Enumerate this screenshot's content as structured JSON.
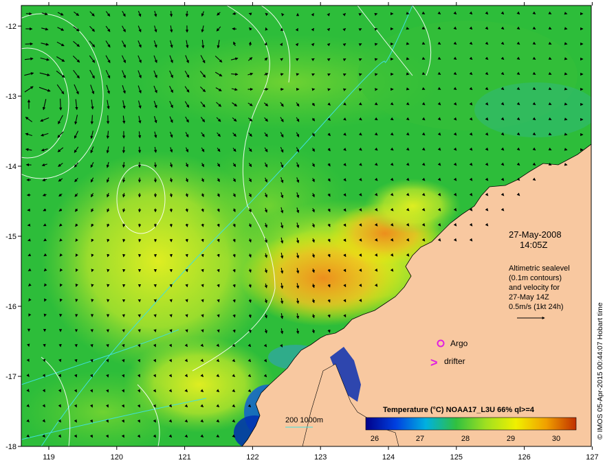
{
  "map": {
    "date_line": "27-May-2008",
    "time_line": "14:05Z",
    "legend_text": [
      "Altimetric sealevel",
      "(0.1m contours)",
      "and velocity for",
      "27-May 14Z",
      "0.5m/s (1kt 24h)"
    ],
    "argo_label": "Argo",
    "drifter_label": "drifter",
    "drifter_marker": ">",
    "bathymetry_label": "200  1000m",
    "colorbar_title": "Temperature (°C) NOAA17_L3U 66% ql>=4",
    "colorbar_ticks": [
      "26",
      "27",
      "28",
      "29",
      "30"
    ],
    "credit": "© IMOS 05-Apr-2015 00:44:07 Hobart time",
    "lon_ticks": [
      "119",
      "120",
      "121",
      "122",
      "123",
      "124",
      "125",
      "126",
      "127"
    ],
    "lat_ticks": [
      "-12",
      "-13",
      "-14",
      "-15",
      "-16",
      "-17",
      "-18"
    ],
    "colors": {
      "land": "#f8c8a0",
      "ocean_base": "#2dbd3a",
      "warm_patch": "#f0a020",
      "argo_marker": "#e020e0",
      "bathymetry_line": "#40e0e0",
      "sealevel_contour": "#ffffff",
      "velocity_arrow": "#000000",
      "colorbar_stops": [
        "#00008a",
        "#0040e0",
        "#00b0e0",
        "#30c040",
        "#a0e020",
        "#f0f000",
        "#f0a000",
        "#c03000"
      ]
    }
  }
}
